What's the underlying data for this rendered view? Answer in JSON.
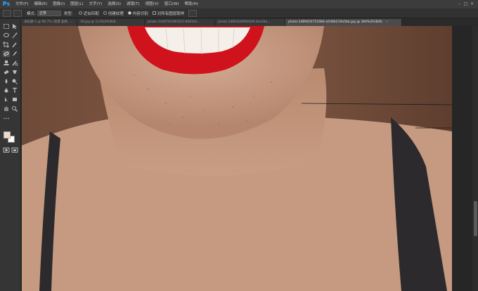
{
  "app": {
    "logo": "Ps"
  },
  "menu": [
    "文件(F)",
    "编辑(E)",
    "图像(I)",
    "图层(L)",
    "文字(Y)",
    "选择(S)",
    "滤镜(T)",
    "视图(V)",
    "窗口(W)",
    "帮助(H)"
  ],
  "window_controls": {
    "minimize": "–",
    "maximize": "□",
    "close": "×"
  },
  "options": {
    "mode_label": "模式:",
    "mode_value": "正常",
    "type_label": "类型:",
    "type_opt1": "近似匹配",
    "type_opt2": "创建纹理",
    "type_opt3": "内容识别",
    "sample_all": "对所有图层取样"
  },
  "tabs": [
    {
      "label": "未标题-1 @ 66.7% (背景 副本, ...",
      "active": false
    },
    {
      "label": "18.jpg @ 113%(RGB/8...",
      "active": false
    },
    {
      "label": "photo-1436761981023-84616e...",
      "active": false
    },
    {
      "label": "photo-1485426992028-3ee34a...",
      "active": false
    },
    {
      "label": "photo-1489424731084-a5d8b219a5bb.jpg @ 384%(RGB/8)",
      "active": true
    }
  ],
  "tab_close": "×",
  "colors": {
    "lips": "#d0121d",
    "skin": "#c99e86",
    "background_brown": "#7a5340",
    "strap": "#2c2a2c",
    "foreground_swatch": "#f5d9c8",
    "background_swatch": "#ffffff"
  },
  "tools": [
    "move-icon",
    "marquee-icon",
    "lasso-icon",
    "magic-wand-icon",
    "crop-icon",
    "eyedropper-icon",
    "spot-healing-icon",
    "brush-icon",
    "clone-stamp-icon",
    "history-brush-icon",
    "eraser-icon",
    "gradient-icon",
    "blur-icon",
    "dodge-icon",
    "pen-icon",
    "type-icon",
    "path-select-icon",
    "shape-icon",
    "hand-icon",
    "zoom-icon"
  ]
}
